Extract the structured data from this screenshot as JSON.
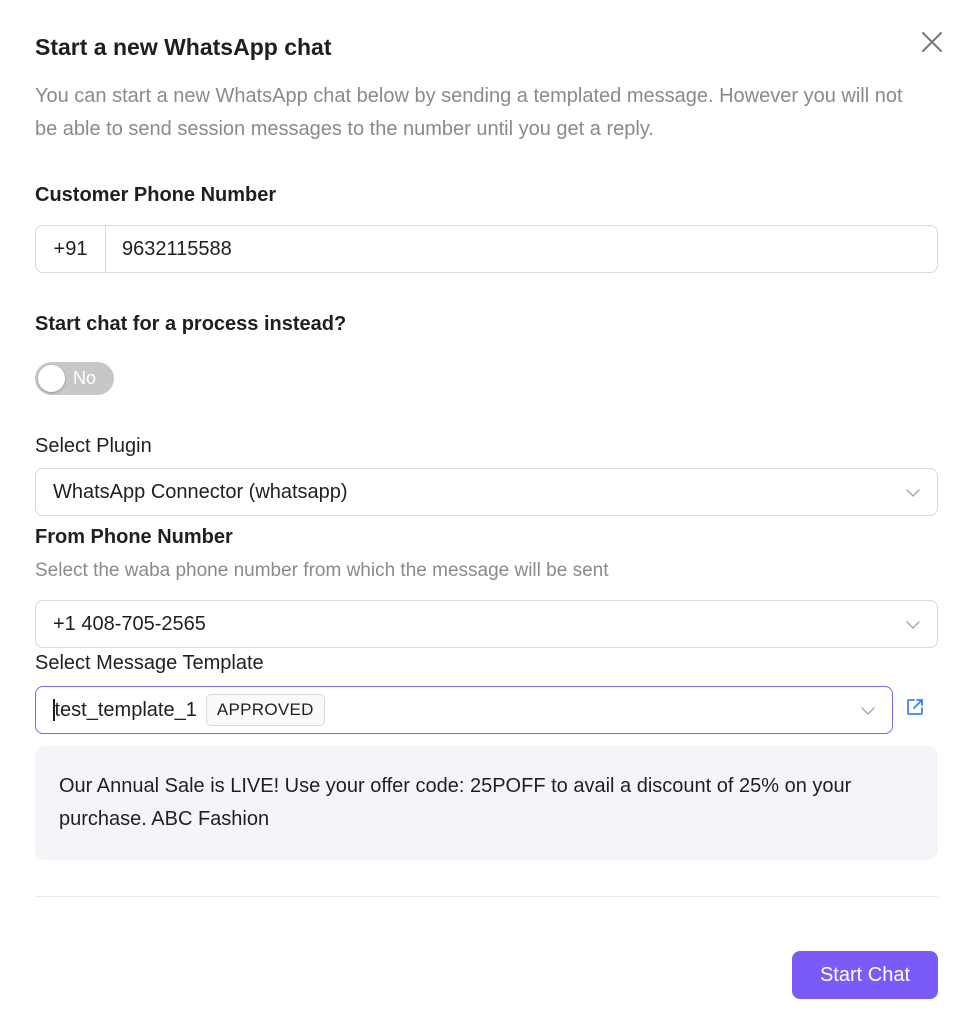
{
  "dialog": {
    "title": "Start a new WhatsApp chat",
    "description": "You can start a new WhatsApp chat below by sending a templated message. However you will not be able to send session messages to the number until you get a reply."
  },
  "customer_phone": {
    "label": "Customer Phone Number",
    "country_code": "+91",
    "value": "9632115588"
  },
  "process_toggle": {
    "label": "Start chat for a process instead?",
    "state_label": "No",
    "on": false
  },
  "plugin": {
    "label": "Select Plugin",
    "value": "WhatsApp Connector (whatsapp)"
  },
  "from_phone": {
    "label": "From Phone Number",
    "hint": "Select the waba phone number from which the message will be sent",
    "value": "+1 408-705-2565"
  },
  "template": {
    "label": "Select Message Template",
    "value": "test_template_1",
    "status": "APPROVED"
  },
  "preview": {
    "text": "Our Annual Sale is LIVE! Use your offer code: 25POFF to avail a discount of 25% on your purchase. ABC Fashion"
  },
  "actions": {
    "start_chat_label": "Start Chat"
  },
  "colors": {
    "primary": "#7a5af8",
    "focus_border": "#7c6ae6",
    "preview_bg": "#f4f5f9",
    "muted_text": "#8a8a8a",
    "link_icon": "#3b82f6"
  },
  "icons": {
    "close": "close-icon",
    "chevron": "chevron-down-icon",
    "external_link": "external-link-icon"
  }
}
